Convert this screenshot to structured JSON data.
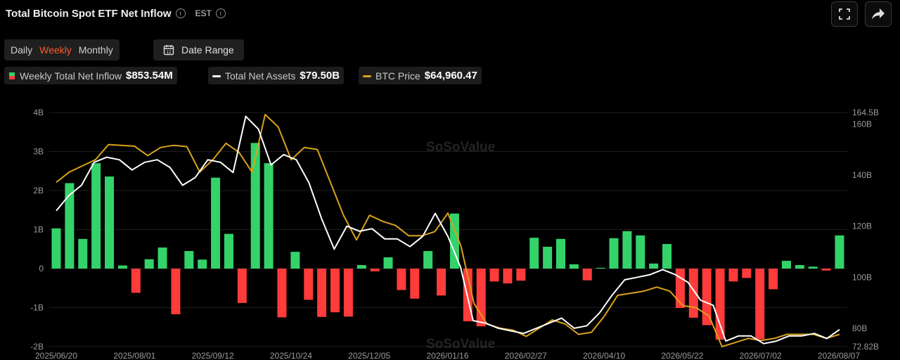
{
  "header": {
    "title": "Total Bitcoin Spot ETF Net Inflow",
    "timezone": "EST"
  },
  "tabs": [
    {
      "label": "Daily"
    },
    {
      "label": "Weekly"
    },
    {
      "label": "Monthly"
    }
  ],
  "date_range_label": "Date Range",
  "legend": [
    {
      "label": "Weekly Total Net Inflow",
      "value": "$853.54M"
    },
    {
      "label": "Total Net Assets",
      "value": "$79.50B"
    },
    {
      "label": "BTC Price",
      "value": "$64,960.47"
    }
  ],
  "watermark": "SoSoValue",
  "colors": {
    "positive": "#33d36a",
    "negative": "#ff3b3b",
    "assets": "#ffffff",
    "price": "#d9a21b",
    "active_tab": "#ff5a2d"
  },
  "icons": {
    "expand": "expand-icon",
    "share": "share-icon",
    "calendar": "calendar-icon"
  },
  "chart_data": {
    "type": "bar",
    "x_tick_labels": [
      "2025/06/20",
      "2025/08/01",
      "2025/09/12",
      "2025/10/24",
      "2025/12/05",
      "2026/01/16",
      "2026/02/27",
      "2026/04/10",
      "2026/05/22",
      "2026/07/02",
      "2026/08/07"
    ],
    "left_ticks": [
      "4B",
      "3B",
      "2B",
      "1B",
      "0",
      "-1B",
      "-2B"
    ],
    "right_ticks": [
      "164.5B",
      "160B",
      "140B",
      "120B",
      "100B",
      "80B",
      "72.82B"
    ],
    "ylim": [
      -2,
      4
    ],
    "y2lim": [
      72.82,
      164.5
    ],
    "net_inflow_billion": [
      1.03,
      2.19,
      0.76,
      2.7,
      2.36,
      0.08,
      -0.62,
      0.24,
      0.54,
      -1.17,
      0.45,
      0.23,
      2.33,
      0.89,
      -0.88,
      3.22,
      2.7,
      -1.25,
      0.43,
      -0.8,
      -1.24,
      -1.12,
      -1.23,
      0.09,
      -0.07,
      0.29,
      -0.55,
      -0.77,
      0.45,
      -0.69,
      1.41,
      -1.35,
      -1.48,
      -0.33,
      -0.38,
      -0.31,
      0.79,
      0.56,
      0.76,
      0.11,
      -0.3,
      0.02,
      0.78,
      0.96,
      0.85,
      0.13,
      0.63,
      -1.01,
      -1.26,
      -1.45,
      -1.82,
      -0.33,
      -0.24,
      -1.81,
      -0.53,
      0.2,
      0.09,
      0.05,
      -0.05,
      0.85
    ],
    "total_net_assets_billion": [
      126,
      132,
      136,
      145,
      147,
      146,
      142,
      145,
      146,
      143,
      136,
      139,
      146,
      145,
      141,
      163,
      158,
      144,
      148,
      146,
      137,
      123,
      111,
      120,
      118,
      119,
      115,
      115,
      112,
      116,
      125,
      116,
      104,
      83,
      82,
      80,
      79,
      78,
      80,
      82,
      84,
      80,
      81,
      86,
      93,
      99,
      100,
      101,
      103,
      101,
      98,
      91,
      89,
      75,
      77,
      77,
      74,
      75,
      77,
      77,
      78,
      76,
      79.5
    ],
    "btc_price_thousand": [
      102,
      104.5,
      106,
      107.5,
      111.2,
      111,
      110.8,
      108.5,
      110.5,
      111,
      110.7,
      104.5,
      107.5,
      111.5,
      109.3,
      104.5,
      118.5,
      115.5,
      107.5,
      110.5,
      110,
      102,
      94,
      88,
      94,
      92.5,
      91.5,
      89,
      89,
      90,
      94.5,
      86.5,
      72.5,
      67.5,
      66.5,
      66,
      64.5,
      66.5,
      68.5,
      67.5,
      65,
      65.5,
      69.5,
      74.5,
      75,
      75.5,
      76.5,
      75.5,
      72,
      71.5,
      69.5,
      62,
      63,
      64,
      63.5,
      64,
      65,
      65,
      65,
      64,
      65
    ]
  }
}
